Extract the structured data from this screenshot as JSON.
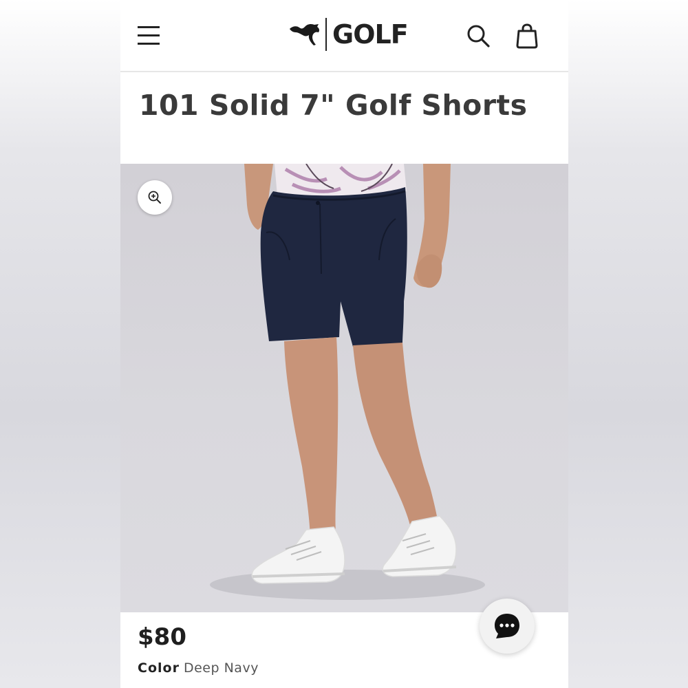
{
  "header": {
    "brand_name": "GOLF",
    "menu_icon": "hamburger-menu-icon",
    "search_icon": "search-icon",
    "bag_icon": "shopping-bag-icon"
  },
  "product": {
    "title": "101 Solid 7\" Golf Shorts",
    "price": "$80",
    "color_label": "Color",
    "color_value": "Deep Navy",
    "zoom_icon": "zoom-in-icon"
  },
  "chat": {
    "icon": "chat-bubble-icon"
  },
  "colors": {
    "shorts": "#1f2740",
    "background": "#d7d6db",
    "text_dark": "#3a3a3a"
  }
}
